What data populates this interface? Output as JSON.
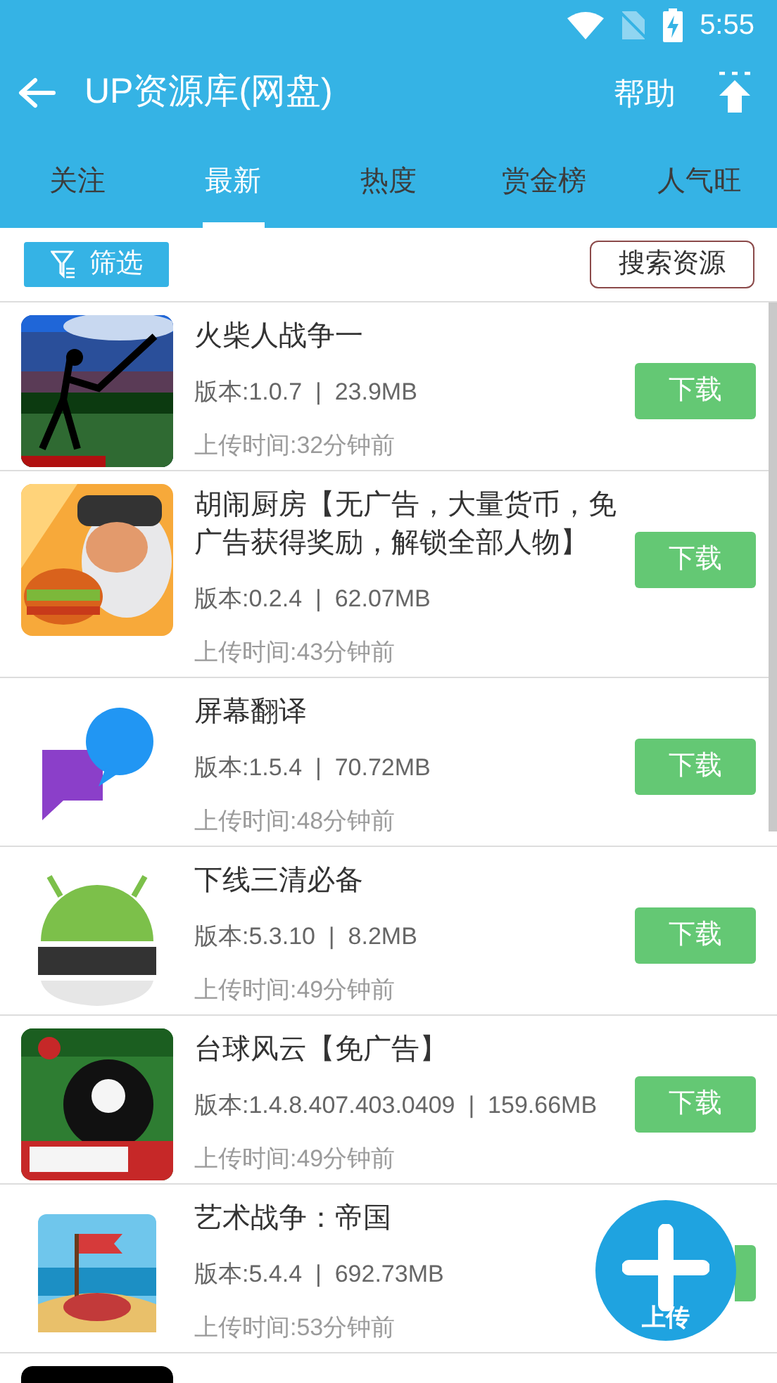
{
  "status_bar": {
    "time": "5:55"
  },
  "toolbar": {
    "title": "UP资源库(网盘)",
    "help": "帮助"
  },
  "tabs": [
    {
      "label": "关注",
      "selected": false
    },
    {
      "label": "最新",
      "selected": true
    },
    {
      "label": "热度",
      "selected": false
    },
    {
      "label": "赏金榜",
      "selected": false
    },
    {
      "label": "人气旺",
      "selected": false
    }
  ],
  "filter_button": "筛选",
  "search_button": "搜索资源",
  "apps": [
    {
      "icon": {
        "kind": "picture"
      },
      "title": "火柴人战争一",
      "info": "版本:1.0.7  |  23.9MB",
      "uploaded": "上传时间:32分钟前",
      "download": "下载"
    },
    {
      "icon": {
        "kind": "picture"
      },
      "title": "胡闹厨房【无广告，大量货币，免广告获得奖励，解锁全部人物】",
      "info": "版本:0.2.4  |  62.07MB",
      "uploaded": "上传时间:43分钟前",
      "download": "下载"
    },
    {
      "icon": {
        "kind": "picture"
      },
      "title": "屏幕翻译",
      "info": "版本:1.5.4  |  70.72MB",
      "uploaded": "上传时间:48分钟前",
      "download": "下载"
    },
    {
      "icon": {
        "kind": "picture"
      },
      "title": "下线三清必备",
      "info": "版本:5.3.10  |  8.2MB",
      "uploaded": "上传时间:49分钟前",
      "download": "下载"
    },
    {
      "icon": {
        "kind": "picture"
      },
      "title": "台球风云【免广告】",
      "info": "版本:1.4.8.407.403.0409  |  159.66MB",
      "uploaded": "上传时间:49分钟前",
      "download": "下载"
    },
    {
      "icon": {
        "kind": "picture"
      },
      "title": "艺术战争：帝国",
      "info": "版本:5.4.4  |  692.73MB",
      "uploaded": "上传时间:53分钟前"
    },
    {
      "icon": {
        "kind": "picture"
      }
    }
  ],
  "fab": {
    "label": "上传"
  }
}
